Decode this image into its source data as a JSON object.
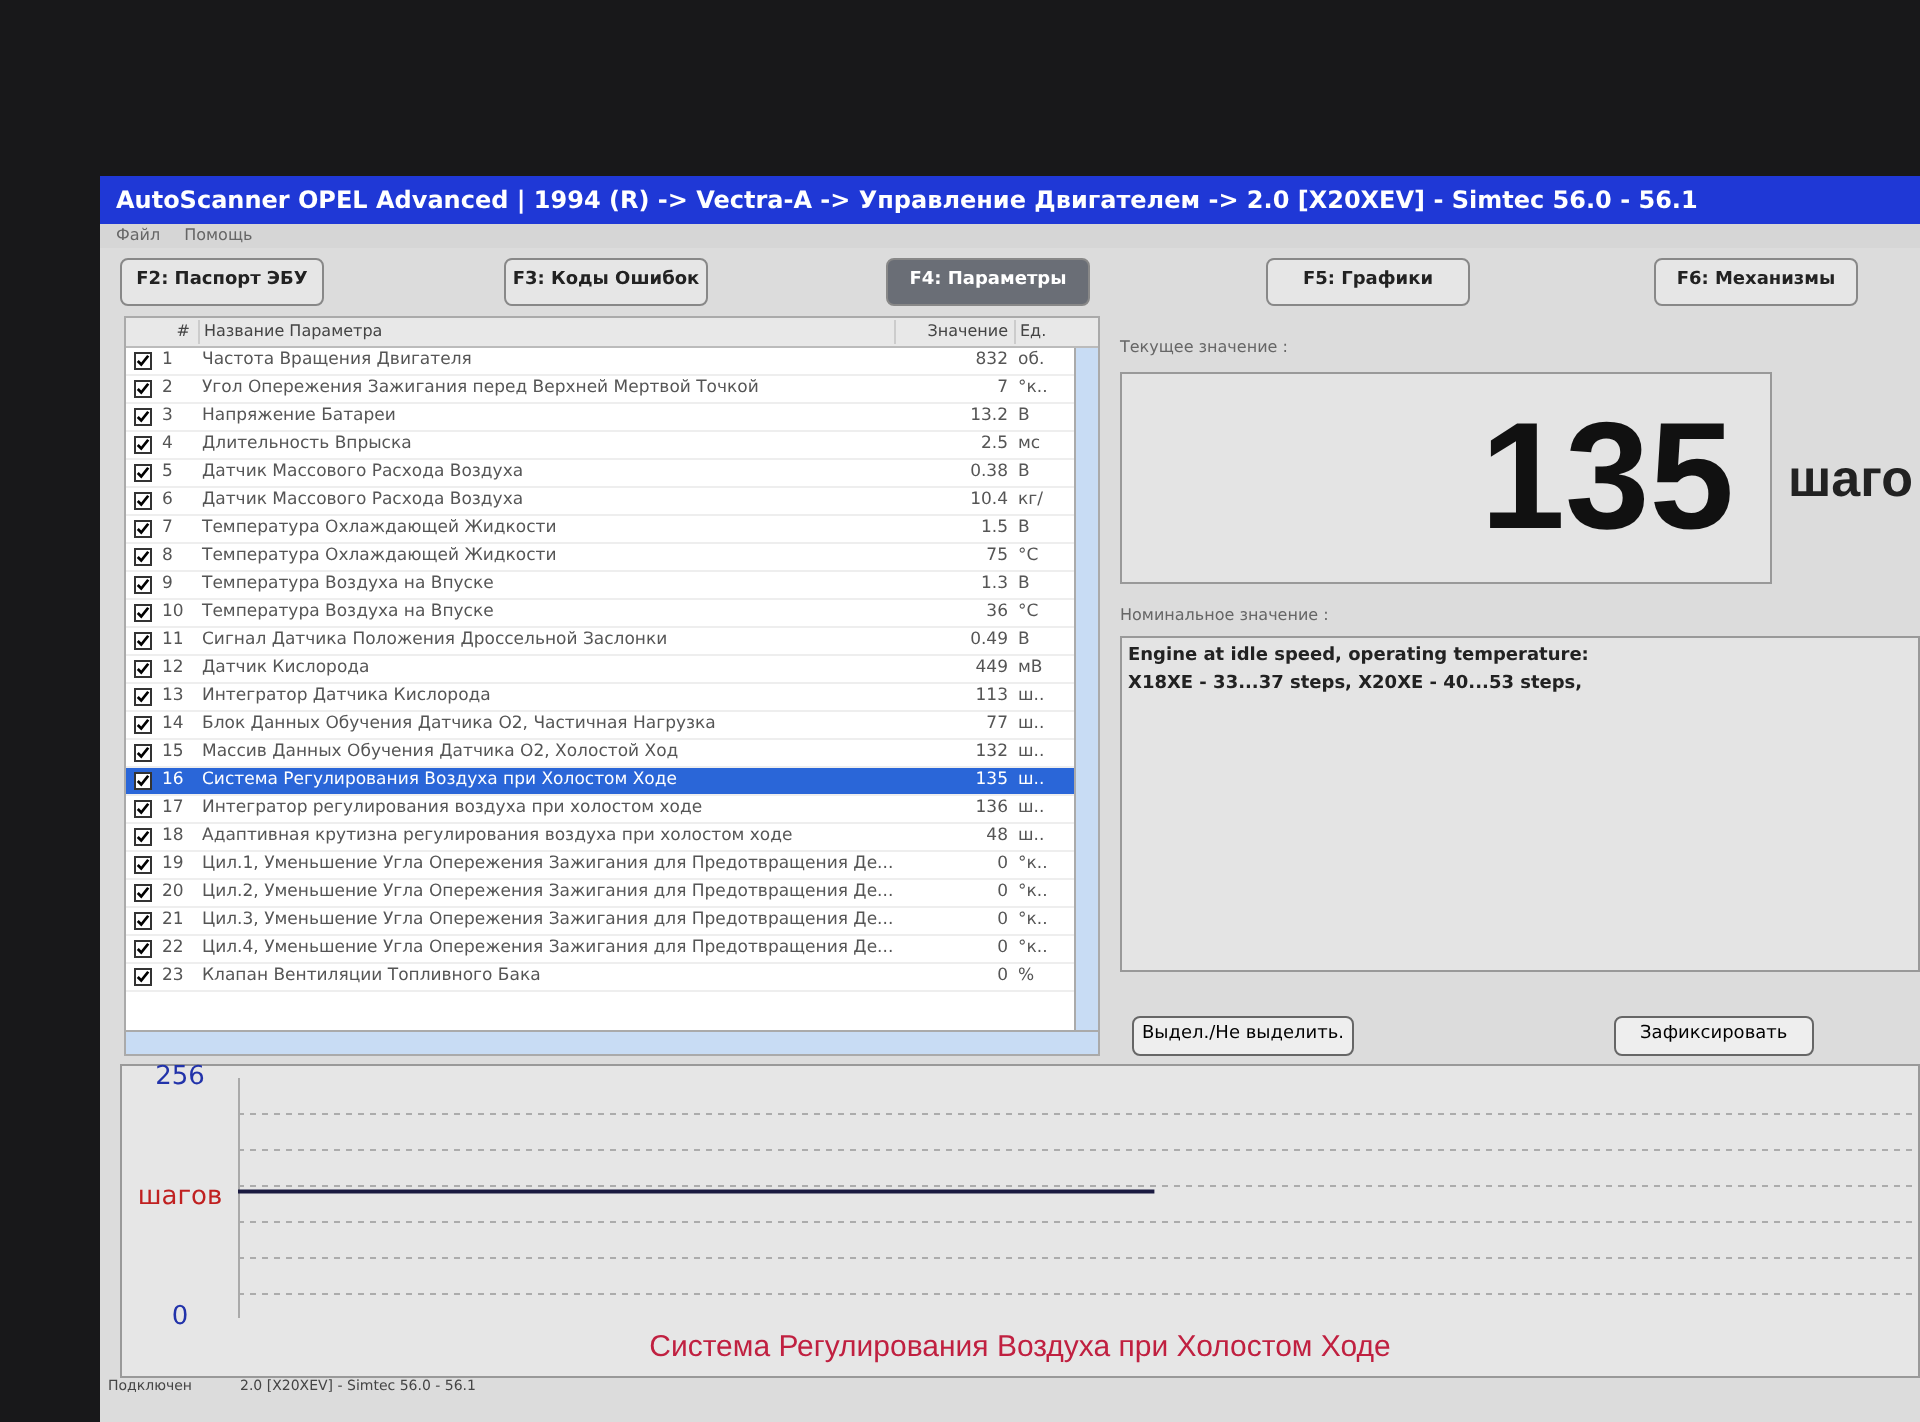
{
  "window": {
    "title": "AutoScanner OPEL Advanced | 1994 (R) -> Vectra-A -> Управление Двигателем -> 2.0 [X20XEV] - Simtec 56.0 - 56.1"
  },
  "menu": [
    "Файл",
    "Помощь"
  ],
  "tabs": [
    {
      "label": "F2: Паспорт ЭБУ",
      "selected": false
    },
    {
      "label": "F3: Коды Ошибок",
      "selected": false
    },
    {
      "label": "F4: Параметры",
      "selected": true
    },
    {
      "label": "F5: Графики",
      "selected": false
    },
    {
      "label": "F6: Механизмы",
      "selected": false
    }
  ],
  "table": {
    "columns": [
      "#",
      "Название Параметра",
      "Значение",
      "Ед."
    ],
    "rows": [
      {
        "checked": true,
        "selected": false,
        "num": "1",
        "name": "Частота Вращения Двигателя",
        "value": "832",
        "unit": "об."
      },
      {
        "checked": true,
        "selected": false,
        "num": "2",
        "name": "Угол Опережения Зажигания перед Верхней Мертвой Точкой",
        "value": "7",
        "unit": "°к.."
      },
      {
        "checked": true,
        "selected": false,
        "num": "3",
        "name": "Напряжение Батареи",
        "value": "13.2",
        "unit": "В"
      },
      {
        "checked": true,
        "selected": false,
        "num": "4",
        "name": "Длительность Впрыска",
        "value": "2.5",
        "unit": "мс"
      },
      {
        "checked": true,
        "selected": false,
        "num": "5",
        "name": "Датчик Массового Расхода Воздуха",
        "value": "0.38",
        "unit": "В"
      },
      {
        "checked": true,
        "selected": false,
        "num": "6",
        "name": "Датчик Массового Расхода Воздуха",
        "value": "10.4",
        "unit": "кг/"
      },
      {
        "checked": true,
        "selected": false,
        "num": "7",
        "name": "Температура Охлаждающей Жидкости",
        "value": "1.5",
        "unit": "В"
      },
      {
        "checked": true,
        "selected": false,
        "num": "8",
        "name": "Температура Охлаждающей Жидкости",
        "value": "75",
        "unit": "°C"
      },
      {
        "checked": true,
        "selected": false,
        "num": "9",
        "name": "Температура Воздуха на Впуске",
        "value": "1.3",
        "unit": "В"
      },
      {
        "checked": true,
        "selected": false,
        "num": "10",
        "name": "Температура Воздуха на Впуске",
        "value": "36",
        "unit": "°C"
      },
      {
        "checked": true,
        "selected": false,
        "num": "11",
        "name": "Сигнал Датчика Положения Дроссельной Заслонки",
        "value": "0.49",
        "unit": "В"
      },
      {
        "checked": true,
        "selected": false,
        "num": "12",
        "name": "Датчик Кислорода",
        "value": "449",
        "unit": "мВ"
      },
      {
        "checked": true,
        "selected": false,
        "num": "13",
        "name": "Интегратор Датчика Кислорода",
        "value": "113",
        "unit": "ш.."
      },
      {
        "checked": true,
        "selected": false,
        "num": "14",
        "name": "Блок Данных Обучения Датчика O2, Частичная Нагрузка",
        "value": "77",
        "unit": "ш.."
      },
      {
        "checked": true,
        "selected": false,
        "num": "15",
        "name": "Массив Данных Обучения Датчика O2, Холостой Ход",
        "value": "132",
        "unit": "ш.."
      },
      {
        "checked": true,
        "selected": true,
        "num": "16",
        "name": "Система Регулирования Воздуха при Холостом Ходе",
        "value": "135",
        "unit": "ш.."
      },
      {
        "checked": true,
        "selected": false,
        "num": "17",
        "name": "Интегратор регулирования воздуха при холостом ходе",
        "value": "136",
        "unit": "ш.."
      },
      {
        "checked": true,
        "selected": false,
        "num": "18",
        "name": "Адаптивная крутизна регулирования воздуха при холостом ходе",
        "value": "48",
        "unit": "ш.."
      },
      {
        "checked": true,
        "selected": false,
        "num": "19",
        "name": "Цил.1, Уменьшение Угла Опережения Зажигания для Предотвращения Де...",
        "value": "0",
        "unit": "°к.."
      },
      {
        "checked": true,
        "selected": false,
        "num": "20",
        "name": "Цил.2, Уменьшение Угла Опережения Зажигания для Предотвращения Де...",
        "value": "0",
        "unit": "°к.."
      },
      {
        "checked": true,
        "selected": false,
        "num": "21",
        "name": "Цил.3, Уменьшение Угла Опережения Зажигания для Предотвращения Де...",
        "value": "0",
        "unit": "°к.."
      },
      {
        "checked": true,
        "selected": false,
        "num": "22",
        "name": "Цил.4, Уменьшение Угла Опережения Зажигания для Предотвращения Де...",
        "value": "0",
        "unit": "°к.."
      },
      {
        "checked": true,
        "selected": false,
        "num": "23",
        "name": "Клапан Вентиляции Топливного Бака",
        "value": "0",
        "unit": "%"
      }
    ]
  },
  "current": {
    "label": "Текущее значение :",
    "value": "135",
    "unit": "шаго"
  },
  "nominal": {
    "label": "Номинальное значение :",
    "text": "Engine at idle speed, operating temperature:\nX18XE - 33...37 steps, X20XE - 40...53 steps,"
  },
  "buttons": [
    "Выдел./Не выделить.",
    "Зафиксировать"
  ],
  "graph": {
    "chart_data": {
      "type": "line",
      "title": "Система Регулирования Воздуха при Холостом Ходе",
      "ylabel": "шагов",
      "ylim": [
        0,
        256
      ],
      "yticks": [
        0,
        256
      ],
      "series": [
        {
          "color": "#1a1a40",
          "values": [
            135,
            135,
            135,
            135,
            135,
            135,
            135,
            null,
            null,
            null,
            null,
            null
          ]
        }
      ]
    }
  },
  "status_bar": [
    "Подключен",
    "2.0 [X20XEV] - Simtec 56.0 - 56.1"
  ]
}
